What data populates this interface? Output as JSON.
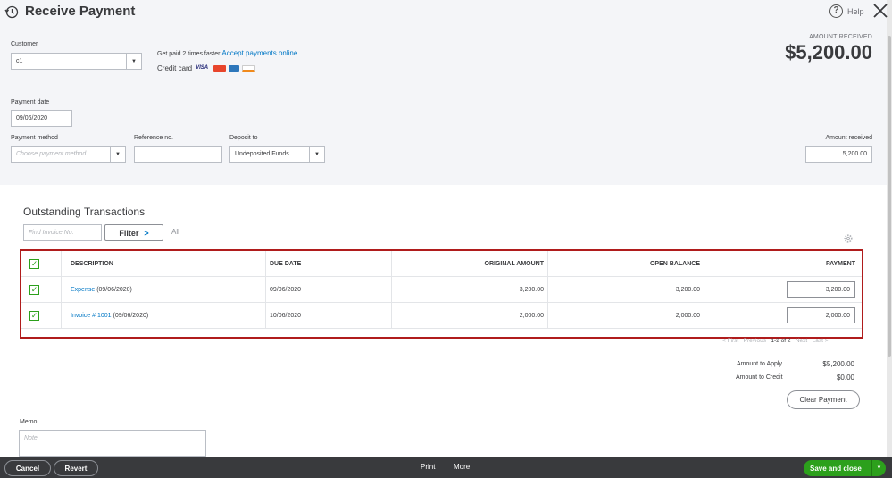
{
  "header": {
    "title": "Receive Payment",
    "help_label": "Help",
    "help_glyph": "?",
    "amount_received_label": "AMOUNT RECEIVED",
    "amount_received_value": "$5,200.00"
  },
  "customer": {
    "label": "Customer",
    "value": "c1"
  },
  "promo": {
    "text": "Get paid 2 times faster",
    "link": "Accept payments online",
    "credit_card_label": "Credit card"
  },
  "cards": [
    {
      "name": "visa",
      "label": "VISA"
    },
    {
      "name": "mastercard",
      "color": "#e8452c"
    },
    {
      "name": "amex",
      "color": "#2e77bb"
    },
    {
      "name": "discover",
      "color": "#f08a1c"
    }
  ],
  "payment_date": {
    "label": "Payment date",
    "value": "09/06/2020"
  },
  "payment_method": {
    "label": "Payment method",
    "placeholder": "Choose payment method"
  },
  "reference": {
    "label": "Reference no.",
    "value": ""
  },
  "deposit_to": {
    "label": "Deposit to",
    "value": "Undeposited Funds"
  },
  "amount_received": {
    "label": "Amount received",
    "value": "5,200.00"
  },
  "outstanding": {
    "title": "Outstanding Transactions",
    "find_placeholder": "Find Invoice No.",
    "filter_label": "Filter",
    "filter_chevron": ">",
    "all_label": "All"
  },
  "table": {
    "columns": [
      "DESCRIPTION",
      "DUE DATE",
      "ORIGINAL AMOUNT",
      "OPEN BALANCE",
      "PAYMENT"
    ],
    "rows": [
      {
        "desc_link": "Expense",
        "desc_rest": " (09/06/2020)",
        "due": "09/06/2020",
        "original": "3,200.00",
        "open": "3,200.00",
        "payment": "3,200.00"
      },
      {
        "desc_link": "Invoice # 1001",
        "desc_rest": " (09/06/2020)",
        "due": "10/06/2020",
        "original": "2,000.00",
        "open": "2,000.00",
        "payment": "2,000.00"
      }
    ],
    "check_glyph": "✓"
  },
  "pager": {
    "first": "< First",
    "previous": "Previous",
    "range": "1-2 of 2",
    "next": "Next",
    "last": "Last >"
  },
  "summary": {
    "apply_label": "Amount to Apply",
    "apply_value": "$5,200.00",
    "credit_label": "Amount to Credit",
    "credit_value": "$0.00",
    "clear_label": "Clear Payment"
  },
  "memo": {
    "label": "Memo",
    "placeholder": "Note"
  },
  "footer": {
    "cancel": "Cancel",
    "revert": "Revert",
    "print": "Print",
    "more": "More",
    "save_close": "Save and close",
    "save_arrow": "▼"
  },
  "colors": {
    "accent_green": "#2ca01c",
    "link_blue": "#0077c5",
    "highlight_red": "#b01c1c",
    "footer_bg": "#393a3d"
  }
}
